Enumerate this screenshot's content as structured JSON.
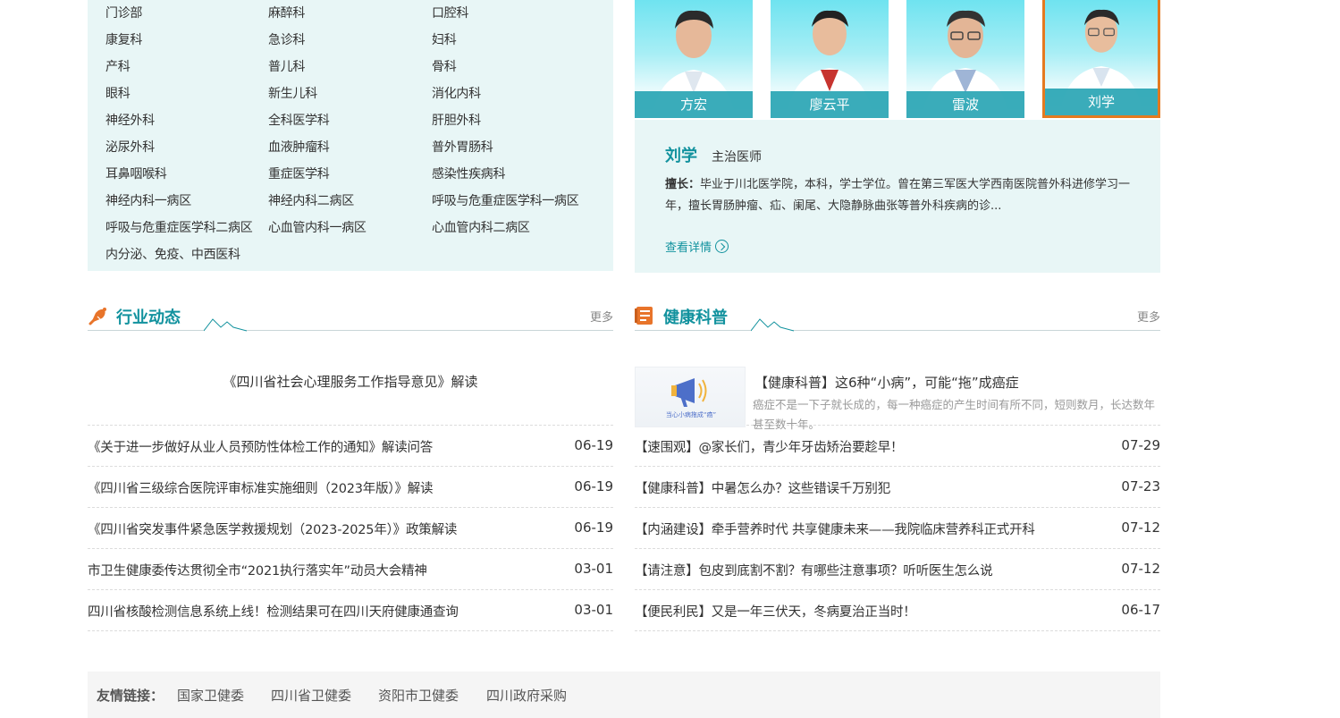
{
  "departments": [
    "门诊部",
    "麻醉科",
    "口腔科",
    "康复科",
    "急诊科",
    "妇科",
    "产科",
    "普儿科",
    "骨科",
    "眼科",
    "新生儿科",
    "消化内科",
    "神经外科",
    "全科医学科",
    "肝胆外科",
    "泌尿外科",
    "血液肿瘤科",
    "普外胃肠科",
    "耳鼻咽喉科",
    "重症医学科",
    "感染性疾病科",
    "神经内科一病区",
    "神经内科二病区",
    "呼吸与危重症医学科一病区",
    "呼吸与危重症医学科二病区",
    "心血管内科一病区",
    "心血管内科二病区",
    "内分泌、免疫、中西医科"
  ],
  "doctors": {
    "cards": [
      {
        "name": "方宏"
      },
      {
        "name": "廖云平"
      },
      {
        "name": "雷波"
      },
      {
        "name": "刘学"
      }
    ],
    "selected": {
      "name": "刘学",
      "title": "主治医师",
      "desc_label": "擅长：",
      "desc": "毕业于川北医学院，本科，学士学位。曾在第三军医大学西南医院普外科进修学习一年，擅长胃肠肿瘤、疝、阑尾、大隐静脉曲张等普外科疾病的诊...",
      "more": "查看详情"
    }
  },
  "industry_news": {
    "title": "行业动态",
    "more": "更多",
    "feature_title": "《四川省社会心理服务工作指导意见》解读",
    "items": [
      {
        "title": "《关于进一步做好从业人员预防性体检工作的通知》解读问答",
        "date": "06-19"
      },
      {
        "title": "《四川省三级综合医院评审标准实施细则（2023年版）》解读",
        "date": "06-19"
      },
      {
        "title": "《四川省突发事件紧急医学救援规划（2023-2025年）》政策解读",
        "date": "06-19"
      },
      {
        "title": "市卫生健康委传达贯彻全市“2021执行落实年”动员大会精神",
        "date": "03-01"
      },
      {
        "title": "四川省核酸检测信息系统上线！检测结果可在四川天府健康通查询",
        "date": "03-01"
      }
    ]
  },
  "health_news": {
    "title": "健康科普",
    "more": "更多",
    "feature_img_text": "当心小病拖成“癌”",
    "feature_title": "【健康科普】这6种“小病”，可能“拖”成癌症",
    "feature_desc": "癌症不是一下子就长成的，每一种癌症的产生时间有所不同，短则数月，长达数年甚至数十年。",
    "items": [
      {
        "title": "【速围观】@家长们，青少年牙齿矫治要趁早！",
        "date": "07-29"
      },
      {
        "title": "【健康科普】中暑怎么办？这些错误千万别犯",
        "date": "07-23"
      },
      {
        "title": "【内涵建设】牵手营养时代 共享健康未来——我院临床营养科正式开科",
        "date": "07-12"
      },
      {
        "title": "【请注意】包皮到底割不割？有哪些注意事项？听听医生怎么说",
        "date": "07-12"
      },
      {
        "title": "【便民利民】又是一年三伏天，冬病夏治正当时！",
        "date": "06-17"
      }
    ]
  },
  "links": {
    "label": "友情链接：",
    "items": [
      "国家卫健委",
      "四川省卫健委",
      "资阳市卫健委",
      "四川政府采购"
    ]
  },
  "colors": {
    "accent": "#12929e",
    "panel_bg": "#e8f6f6",
    "active_border": "#e57a1f",
    "icon_orange": "#e8742a"
  },
  "icons": {
    "industry": "bell-megaphone-icon",
    "health": "book-icon",
    "more_details": "circle-arrow-right-icon"
  }
}
